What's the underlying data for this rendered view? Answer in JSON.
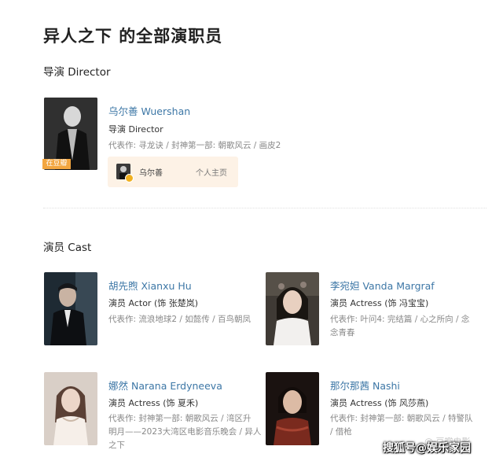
{
  "page": {
    "title": "异人之下 的全部演职员"
  },
  "director_section": {
    "heading": "导演 Director",
    "director": {
      "name": "乌尔善 Wuershan",
      "role": "导演 Director",
      "works": "代表作:  寻龙诀 / 封神第一部: 朝歌风云 / 画皮2",
      "badge": "在豆瓣",
      "profile_card": {
        "name": "乌尔善",
        "link_label": "个人主页"
      }
    }
  },
  "cast_section": {
    "heading": "演员 Cast",
    "members": [
      {
        "name": "胡先煦 Xianxu Hu",
        "role": "演员 Actor (饰 张楚岚)",
        "works": [
          "代表作:  流浪地球2 / 如懿传 / 百鸟朝凤"
        ]
      },
      {
        "name": "李宛妲 Vanda Margraf",
        "role": "演员 Actress (饰 冯宝宝)",
        "works": [
          "代表作:  叶问4: 完结篇 / 心之所向 / 念",
          "念青春"
        ]
      },
      {
        "name": "娜然 Narana Erdyneeva",
        "role": "演员 Actress (饰 夏禾)",
        "works": [
          "代表作:  封神第一部: 朝歌风云 / 湾区升",
          "明月——2023大湾区电影音乐晚会 / 异人",
          "之下"
        ]
      },
      {
        "name": "那尔那茜 Nashi",
        "role": "演员 Actress (饰 风莎燕)",
        "works": [
          "代表作:  封神第一部: 朝歌风云 / 特警队",
          "/ 借枪"
        ]
      }
    ]
  },
  "watermark": {
    "small": "@ 豆瓣电影",
    "main": "搜狐号@娱乐家园"
  }
}
